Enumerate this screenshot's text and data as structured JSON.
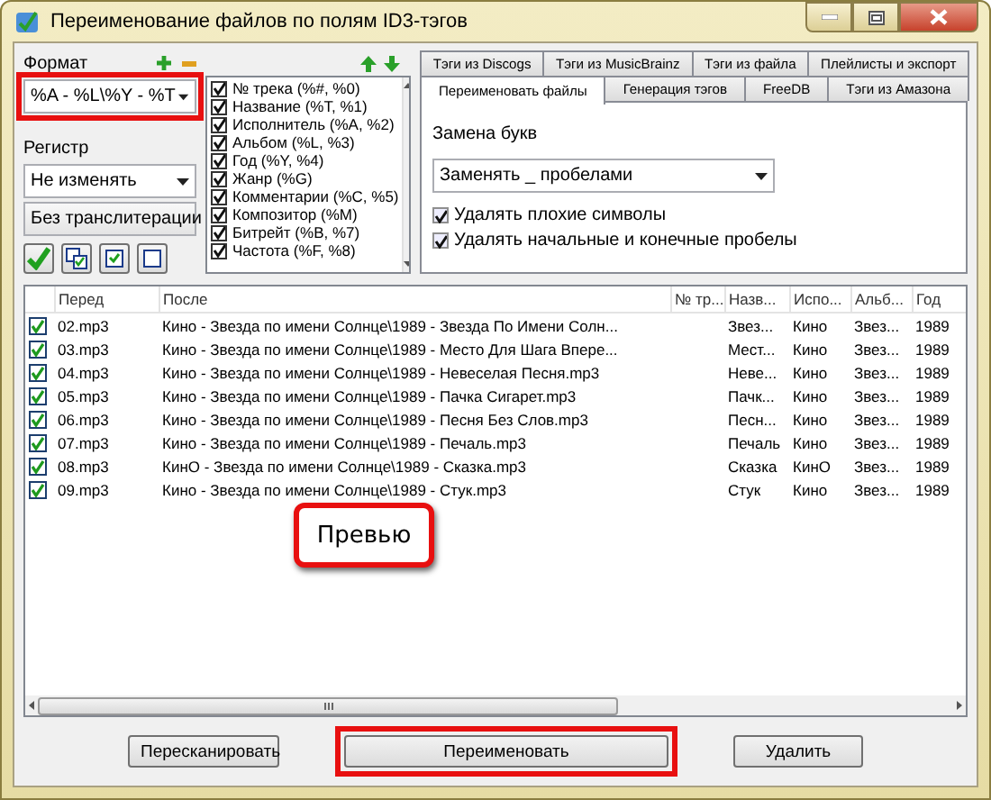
{
  "window": {
    "title": "Переименование файлов по полям ID3-тэгов"
  },
  "format": {
    "label": "Формат",
    "value": "%A - %L\\%Y - %T",
    "highlighted": true
  },
  "register": {
    "label": "Регистр",
    "case": "Не изменять",
    "transliteration": "Без транслитерации"
  },
  "fields": [
    {
      "label": "№ трека (%#, %0)",
      "checked": true
    },
    {
      "label": "Название (%T, %1)",
      "checked": true
    },
    {
      "label": "Исполнитель (%A, %2)",
      "checked": true
    },
    {
      "label": "Альбом (%L, %3)",
      "checked": true
    },
    {
      "label": "Год (%Y, %4)",
      "checked": true
    },
    {
      "label": "Жанр (%G)",
      "checked": true
    },
    {
      "label": "Комментарии (%C, %5)",
      "checked": true
    },
    {
      "label": "Композитор (%M)",
      "checked": true
    },
    {
      "label": "Битрейт (%B, %7)",
      "checked": true
    },
    {
      "label": "Частота (%F, %8)",
      "checked": true
    }
  ],
  "tabs": [
    [
      {
        "label": "Тэги из Discogs",
        "selected": false
      },
      {
        "label": "Тэги из MusicBrainz",
        "selected": false
      },
      {
        "label": "Тэги из файла",
        "selected": false
      },
      {
        "label": "Плейлисты и экспорт",
        "selected": false
      }
    ],
    [
      {
        "label": "Переименовать файлы",
        "selected": true
      },
      {
        "label": "Генерация тэгов",
        "selected": false
      },
      {
        "label": "FreeDB",
        "selected": false
      },
      {
        "label": "Тэги из Амазона",
        "selected": false
      }
    ]
  ],
  "replace": {
    "label": "Замена букв",
    "value": "Заменять _ пробелами"
  },
  "options": [
    {
      "label": "Удалять плохие символы",
      "checked": true
    },
    {
      "label": "Удалять начальные и конечные пробелы",
      "checked": true
    }
  ],
  "table": {
    "columns": [
      "Перед",
      "После",
      "№ тр...",
      "Назв...",
      "Испо...",
      "Альб...",
      "Год"
    ],
    "rows": [
      {
        "checked": true,
        "before": "02.mp3",
        "after": "Кино - Звезда по имени Солнце\\1989 - Звезда По Имени Солн...",
        "title": "Звез...",
        "artist": "Кино",
        "album": "Звез...",
        "year": "1989"
      },
      {
        "checked": true,
        "before": "03.mp3",
        "after": "Кино - Звезда по имени Солнце\\1989 - Место Для Шага Впере...",
        "title": "Мест...",
        "artist": "Кино",
        "album": "Звез...",
        "year": "1989"
      },
      {
        "checked": true,
        "before": "04.mp3",
        "after": "Кино - Звезда по имени Солнце\\1989 - Невеселая Песня.mp3",
        "title": "Неве...",
        "artist": "Кино",
        "album": "Звез...",
        "year": "1989"
      },
      {
        "checked": true,
        "before": "05.mp3",
        "after": "Кино - Звезда по имени Солнце\\1989 - Пачка Сигарет.mp3",
        "title": "Пачк...",
        "artist": "Кино",
        "album": "Звез...",
        "year": "1989"
      },
      {
        "checked": true,
        "before": "06.mp3",
        "after": "Кино - Звезда по имени Солнце\\1989 - Песня Без Слов.mp3",
        "title": "Песн...",
        "artist": "Кино",
        "album": "Звез...",
        "year": "1989"
      },
      {
        "checked": true,
        "before": "07.mp3",
        "after": "Кино - Звезда по имени Солнце\\1989 - Печаль.mp3",
        "title": "Печаль",
        "artist": "Кино",
        "album": "Звез...",
        "year": "1989"
      },
      {
        "checked": true,
        "before": "08.mp3",
        "after": "КинО - Звезда по имени Солнце\\1989 - Сказка.mp3",
        "title": "Сказка",
        "artist": "КинО",
        "album": "Звез...",
        "year": "1989"
      },
      {
        "checked": true,
        "before": "09.mp3",
        "after": "Кино - Звезда по имени Солнце\\1989 - Стук.mp3",
        "title": "Стук",
        "artist": "Кино",
        "album": "Звез...",
        "year": "1989"
      }
    ]
  },
  "callout": {
    "text": "Превью"
  },
  "buttons": [
    {
      "label": "Пересканировать",
      "highlighted": false
    },
    {
      "label": "Переименовать",
      "highlighted": true
    },
    {
      "label": "Удалить",
      "highlighted": false
    }
  ]
}
